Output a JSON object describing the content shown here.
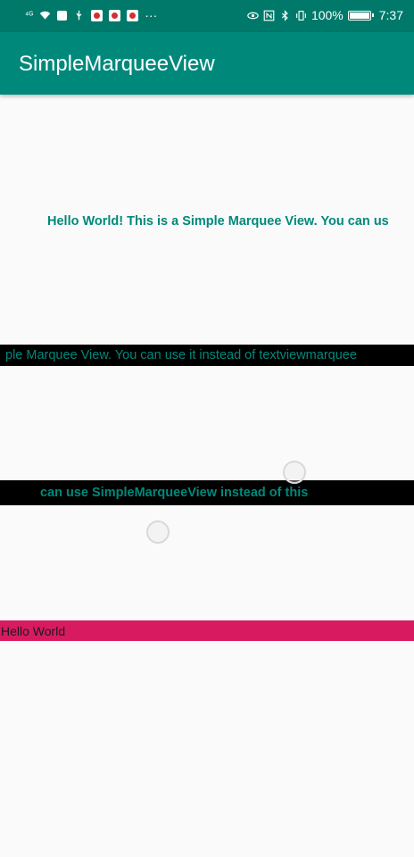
{
  "status_bar": {
    "signal": "⁴ᴳ",
    "battery_percent": "100%",
    "time": "7:37"
  },
  "app_bar": {
    "title": "SimpleMarqueeView"
  },
  "marquees": {
    "marquee1_text": "Hello World! This is a Simple Marquee View. You can us",
    "marquee2_text": "ple Marquee View. You can use it instead of textviewmarquee",
    "marquee3_text": "can use SimpleMarqueeView instead of this",
    "marquee4_text": "Hello World"
  },
  "colors": {
    "primary_dark": "#00796b",
    "primary": "#00897b",
    "accent_bar": "#d81b60"
  }
}
